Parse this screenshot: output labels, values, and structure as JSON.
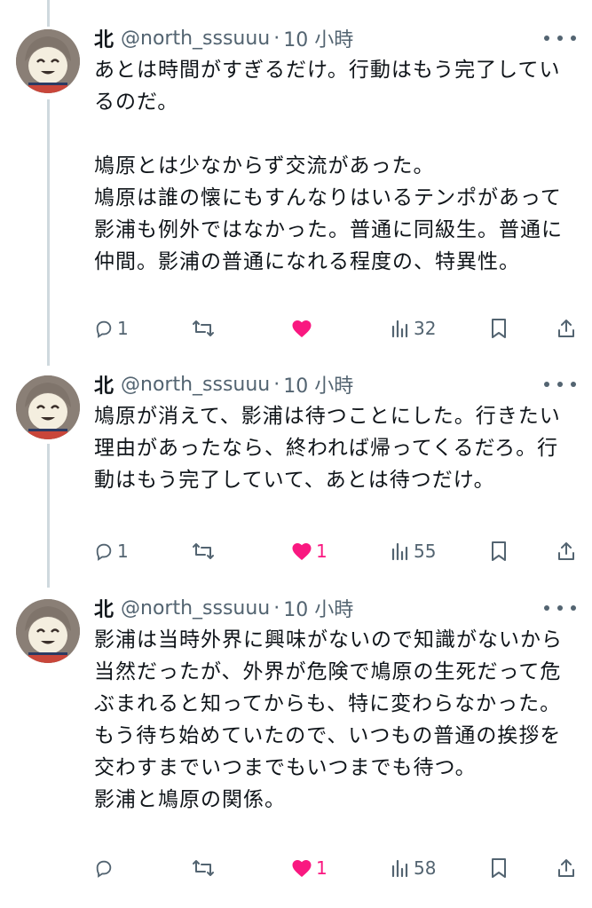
{
  "tweets": [
    {
      "name": "北",
      "handle": "@north_sssuuu",
      "separator": "·",
      "time": "10 小時",
      "text": "あとは時間がすぎるだけ。行動はもう完了しているのだ。\n\n鳩原とは少なからず交流があった。\n鳩原は誰の懐にもすんなりはいるテンポがあって影浦も例外ではなかった。普通に同級生。普通に仲間。影浦の普通になれる程度の、特異性。",
      "replies": "1",
      "retweets": "",
      "likes": "",
      "liked": true,
      "views": "32"
    },
    {
      "name": "北",
      "handle": "@north_sssuuu",
      "separator": "·",
      "time": "10 小時",
      "text": "鳩原が消えて、影浦は待つことにした。行きたい理由があったなら、終われば帰ってくるだろ。行動はもう完了していて、あとは待つだけ。",
      "replies": "1",
      "retweets": "",
      "likes": "1",
      "liked": true,
      "views": "55"
    },
    {
      "name": "北",
      "handle": "@north_sssuuu",
      "separator": "·",
      "time": "10 小時",
      "text": "影浦は当時外界に興味がないので知識がないから当然だったが、外界が危険で鳩原の生死だって危ぶまれると知ってからも、特に変わらなかった。もう待ち始めていたので、いつもの普通の挨拶を交わすまでいつまでもいつまでも待つ。\n影浦と鳩原の関係。",
      "replies": "",
      "retweets": "",
      "likes": "1",
      "liked": true,
      "views": "58"
    }
  ],
  "colors": {
    "like": "#f91880",
    "muted": "#536471",
    "text": "#0f1419",
    "thread_line": "#cfd9de"
  },
  "icons": [
    "reply-icon",
    "retweet-icon",
    "heart-icon",
    "views-icon",
    "bookmark-icon",
    "share-icon",
    "more-icon"
  ]
}
